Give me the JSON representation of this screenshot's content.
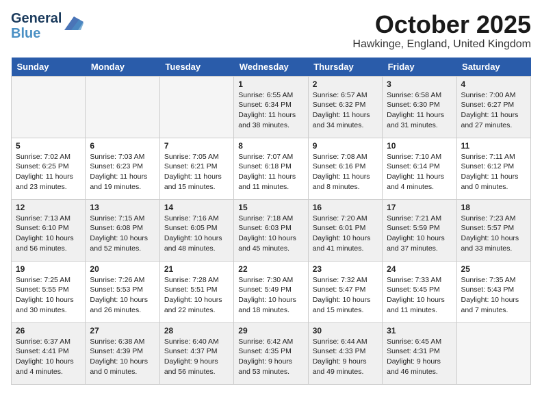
{
  "header": {
    "logo_line1": "General",
    "logo_line2": "Blue",
    "month": "October 2025",
    "location": "Hawkinge, England, United Kingdom"
  },
  "days_of_week": [
    "Sunday",
    "Monday",
    "Tuesday",
    "Wednesday",
    "Thursday",
    "Friday",
    "Saturday"
  ],
  "weeks": [
    [
      {
        "day": "",
        "info": ""
      },
      {
        "day": "",
        "info": ""
      },
      {
        "day": "",
        "info": ""
      },
      {
        "day": "1",
        "info": "Sunrise: 6:55 AM\nSunset: 6:34 PM\nDaylight: 11 hours\nand 38 minutes."
      },
      {
        "day": "2",
        "info": "Sunrise: 6:57 AM\nSunset: 6:32 PM\nDaylight: 11 hours\nand 34 minutes."
      },
      {
        "day": "3",
        "info": "Sunrise: 6:58 AM\nSunset: 6:30 PM\nDaylight: 11 hours\nand 31 minutes."
      },
      {
        "day": "4",
        "info": "Sunrise: 7:00 AM\nSunset: 6:27 PM\nDaylight: 11 hours\nand 27 minutes."
      }
    ],
    [
      {
        "day": "5",
        "info": "Sunrise: 7:02 AM\nSunset: 6:25 PM\nDaylight: 11 hours\nand 23 minutes."
      },
      {
        "day": "6",
        "info": "Sunrise: 7:03 AM\nSunset: 6:23 PM\nDaylight: 11 hours\nand 19 minutes."
      },
      {
        "day": "7",
        "info": "Sunrise: 7:05 AM\nSunset: 6:21 PM\nDaylight: 11 hours\nand 15 minutes."
      },
      {
        "day": "8",
        "info": "Sunrise: 7:07 AM\nSunset: 6:18 PM\nDaylight: 11 hours\nand 11 minutes."
      },
      {
        "day": "9",
        "info": "Sunrise: 7:08 AM\nSunset: 6:16 PM\nDaylight: 11 hours\nand 8 minutes."
      },
      {
        "day": "10",
        "info": "Sunrise: 7:10 AM\nSunset: 6:14 PM\nDaylight: 11 hours\nand 4 minutes."
      },
      {
        "day": "11",
        "info": "Sunrise: 7:11 AM\nSunset: 6:12 PM\nDaylight: 11 hours\nand 0 minutes."
      }
    ],
    [
      {
        "day": "12",
        "info": "Sunrise: 7:13 AM\nSunset: 6:10 PM\nDaylight: 10 hours\nand 56 minutes."
      },
      {
        "day": "13",
        "info": "Sunrise: 7:15 AM\nSunset: 6:08 PM\nDaylight: 10 hours\nand 52 minutes."
      },
      {
        "day": "14",
        "info": "Sunrise: 7:16 AM\nSunset: 6:05 PM\nDaylight: 10 hours\nand 48 minutes."
      },
      {
        "day": "15",
        "info": "Sunrise: 7:18 AM\nSunset: 6:03 PM\nDaylight: 10 hours\nand 45 minutes."
      },
      {
        "day": "16",
        "info": "Sunrise: 7:20 AM\nSunset: 6:01 PM\nDaylight: 10 hours\nand 41 minutes."
      },
      {
        "day": "17",
        "info": "Sunrise: 7:21 AM\nSunset: 5:59 PM\nDaylight: 10 hours\nand 37 minutes."
      },
      {
        "day": "18",
        "info": "Sunrise: 7:23 AM\nSunset: 5:57 PM\nDaylight: 10 hours\nand 33 minutes."
      }
    ],
    [
      {
        "day": "19",
        "info": "Sunrise: 7:25 AM\nSunset: 5:55 PM\nDaylight: 10 hours\nand 30 minutes."
      },
      {
        "day": "20",
        "info": "Sunrise: 7:26 AM\nSunset: 5:53 PM\nDaylight: 10 hours\nand 26 minutes."
      },
      {
        "day": "21",
        "info": "Sunrise: 7:28 AM\nSunset: 5:51 PM\nDaylight: 10 hours\nand 22 minutes."
      },
      {
        "day": "22",
        "info": "Sunrise: 7:30 AM\nSunset: 5:49 PM\nDaylight: 10 hours\nand 18 minutes."
      },
      {
        "day": "23",
        "info": "Sunrise: 7:32 AM\nSunset: 5:47 PM\nDaylight: 10 hours\nand 15 minutes."
      },
      {
        "day": "24",
        "info": "Sunrise: 7:33 AM\nSunset: 5:45 PM\nDaylight: 10 hours\nand 11 minutes."
      },
      {
        "day": "25",
        "info": "Sunrise: 7:35 AM\nSunset: 5:43 PM\nDaylight: 10 hours\nand 7 minutes."
      }
    ],
    [
      {
        "day": "26",
        "info": "Sunrise: 6:37 AM\nSunset: 4:41 PM\nDaylight: 10 hours\nand 4 minutes."
      },
      {
        "day": "27",
        "info": "Sunrise: 6:38 AM\nSunset: 4:39 PM\nDaylight: 10 hours\nand 0 minutes."
      },
      {
        "day": "28",
        "info": "Sunrise: 6:40 AM\nSunset: 4:37 PM\nDaylight: 9 hours\nand 56 minutes."
      },
      {
        "day": "29",
        "info": "Sunrise: 6:42 AM\nSunset: 4:35 PM\nDaylight: 9 hours\nand 53 minutes."
      },
      {
        "day": "30",
        "info": "Sunrise: 6:44 AM\nSunset: 4:33 PM\nDaylight: 9 hours\nand 49 minutes."
      },
      {
        "day": "31",
        "info": "Sunrise: 6:45 AM\nSunset: 4:31 PM\nDaylight: 9 hours\nand 46 minutes."
      },
      {
        "day": "",
        "info": ""
      }
    ]
  ]
}
